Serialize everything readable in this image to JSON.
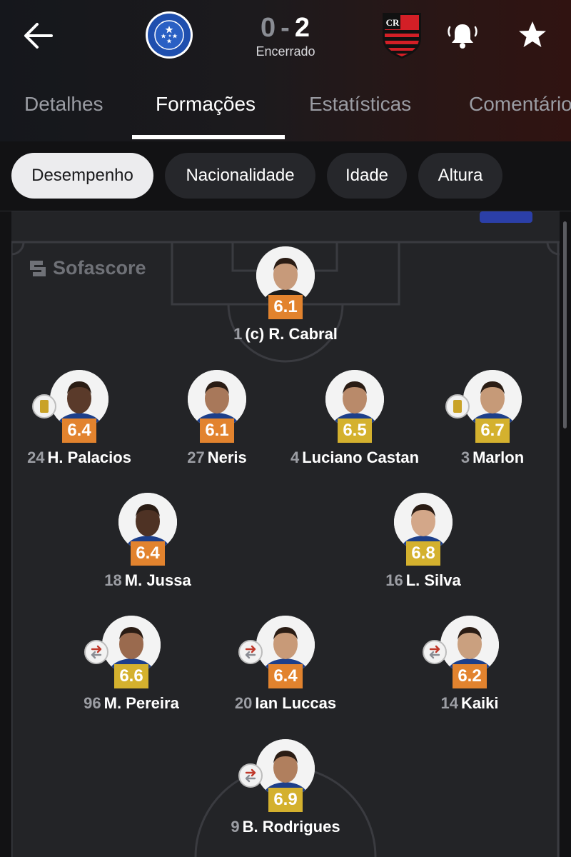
{
  "header": {
    "home_team": "Cruzeiro",
    "away_team": "Flamengo",
    "score_home": "0",
    "score_separator": "-",
    "score_away": "2",
    "status": "Encerrado"
  },
  "tabs": [
    {
      "label": "Detalhes"
    },
    {
      "label": "Formações",
      "active": true
    },
    {
      "label": "Estatísticas"
    },
    {
      "label": "Comentários"
    }
  ],
  "filters": [
    {
      "label": "Desempenho",
      "active": true
    },
    {
      "label": "Nacionalidade"
    },
    {
      "label": "Idade"
    },
    {
      "label": "Altura"
    }
  ],
  "watermark": "Sofascore",
  "colors": {
    "rating_orange": "#e2832e",
    "rating_yellow": "#d4b12e",
    "pitch": "#232427"
  },
  "players": [
    {
      "number": "1",
      "name": "(c) R. Cabral",
      "rating": "6.1",
      "rating_color": "#e2832e"
    },
    {
      "number": "24",
      "name": "H. Palacios",
      "rating": "6.4",
      "rating_color": "#e2832e",
      "badge": "yellow-card-icon"
    },
    {
      "number": "27",
      "name": "Neris",
      "rating": "6.1",
      "rating_color": "#e2832e"
    },
    {
      "number": "4",
      "name": "Luciano Castan",
      "rating": "6.5",
      "rating_color": "#d4b12e"
    },
    {
      "number": "3",
      "name": "Marlon",
      "rating": "6.7",
      "rating_color": "#d4b12e",
      "badge": "yellow-card-icon"
    },
    {
      "number": "18",
      "name": "M. Jussa",
      "rating": "6.4",
      "rating_color": "#e2832e"
    },
    {
      "number": "16",
      "name": "L. Silva",
      "rating": "6.8",
      "rating_color": "#d4b12e"
    },
    {
      "number": "96",
      "name": "M. Pereira",
      "rating": "6.6",
      "rating_color": "#d4b12e",
      "badge": "substitution-icon"
    },
    {
      "number": "20",
      "name": "Ian Luccas",
      "rating": "6.4",
      "rating_color": "#e2832e",
      "badge": "substitution-icon"
    },
    {
      "number": "14",
      "name": "Kaiki",
      "rating": "6.2",
      "rating_color": "#e2832e",
      "badge": "substitution-icon"
    },
    {
      "number": "9",
      "name": "B. Rodrigues",
      "rating": "6.9",
      "rating_color": "#d4b12e",
      "badge": "substitution-icon"
    }
  ]
}
